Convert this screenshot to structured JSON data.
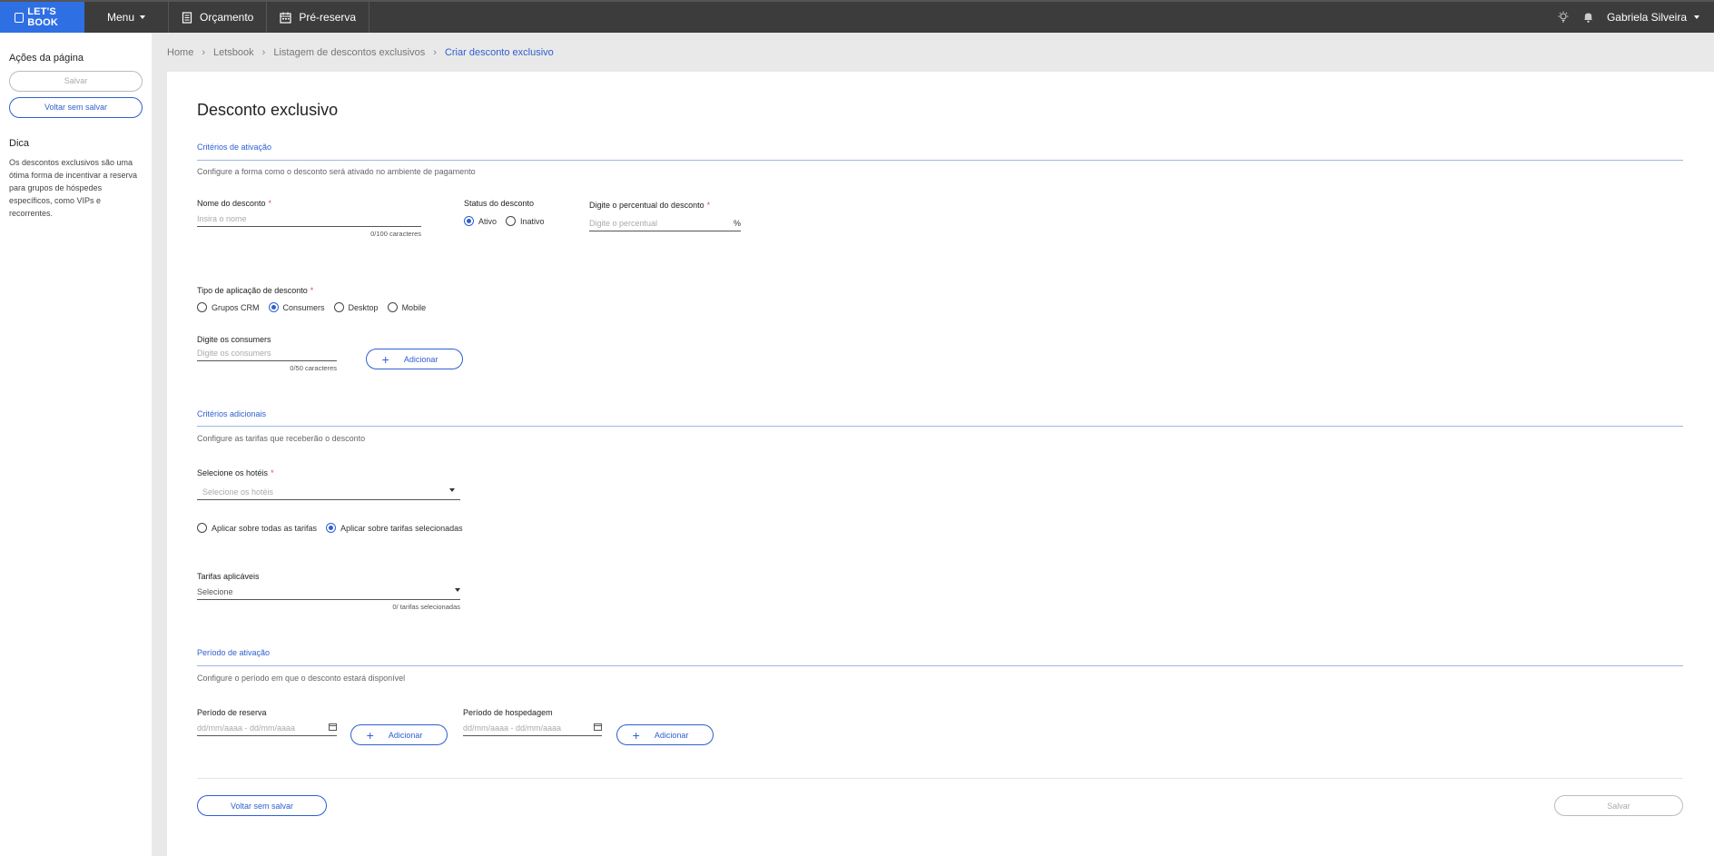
{
  "topbar": {
    "brand": "LET'S BOOK",
    "menu_label": "Menu",
    "items": [
      {
        "label": "Orçamento",
        "icon": "document-icon"
      },
      {
        "label": "Pré-reserva",
        "icon": "calendar-icon"
      }
    ],
    "user_name": "Gabriela Silveira"
  },
  "sidebar": {
    "actions_title": "Ações da página",
    "save_label": "Salvar",
    "back_label": "Voltar sem salvar",
    "tip_title": "Dica",
    "tip_text": "Os descontos exclusivos são uma ótima forma de incentivar a reserva para grupos de hóspedes específicos, como VIPs e recorrentes."
  },
  "breadcrumb": [
    "Home",
    "Letsbook",
    "Listagem de descontos exclusivos",
    "Criar desconto exclusivo"
  ],
  "page": {
    "title": "Desconto exclusivo",
    "activation": {
      "title": "Critérios de ativação",
      "description": "Configure a forma como o desconto será ativado no ambiente de pagamento",
      "name_label": "Nome do desconto",
      "name_placeholder": "Insira o nome",
      "name_counter": "0/100 caracteres",
      "status_label": "Status do desconto",
      "status_options": [
        "Ativo",
        "Inativo"
      ],
      "status_selected": "Ativo",
      "percent_label": "Digite o percentual do desconto",
      "percent_placeholder": "Digite o percentual",
      "percent_suffix": "%",
      "type_label": "Tipo de aplicação de desconto",
      "type_options": [
        "Grupos CRM",
        "Consumers",
        "Desktop",
        "Mobile"
      ],
      "type_selected": "Consumers",
      "consumers_label": "Digite os consumers",
      "consumers_placeholder": "Digite os consumers",
      "consumers_counter": "0/50 caracteres",
      "add_label": "Adicionar"
    },
    "additional": {
      "title": "Critérios adicionais",
      "description": "Configure as tarifas que receberão o desconto",
      "hotels_label": "Selecione os hotéis",
      "hotels_placeholder": "Selecione os hotéis",
      "apply_options": [
        "Aplicar sobre todas as tarifas",
        "Aplicar sobre tarifas selecionadas"
      ],
      "apply_selected": "Aplicar sobre tarifas selecionadas",
      "rates_label": "Tarifas aplicáveis",
      "rates_placeholder": "Selecione",
      "rates_counter": "0/ tarifas selecionadas"
    },
    "period": {
      "title": "Período de ativação",
      "description": "Configure o período em que o desconto estará disponível",
      "booking_label": "Período de reserva",
      "booking_placeholder": "dd/mm/aaaa - dd/mm/aaaa",
      "stay_label": "Período de hospedagem",
      "stay_placeholder": "dd/mm/aaaa - dd/mm/aaaa",
      "add_label": "Adicionar"
    },
    "footer": {
      "back_label": "Voltar sem salvar",
      "save_label": "Salvar"
    }
  },
  "colors": {
    "accent": "#2f5fd0",
    "brand": "#2f6fe4",
    "topbar": "#3c3c3c",
    "required": "#e05050"
  }
}
